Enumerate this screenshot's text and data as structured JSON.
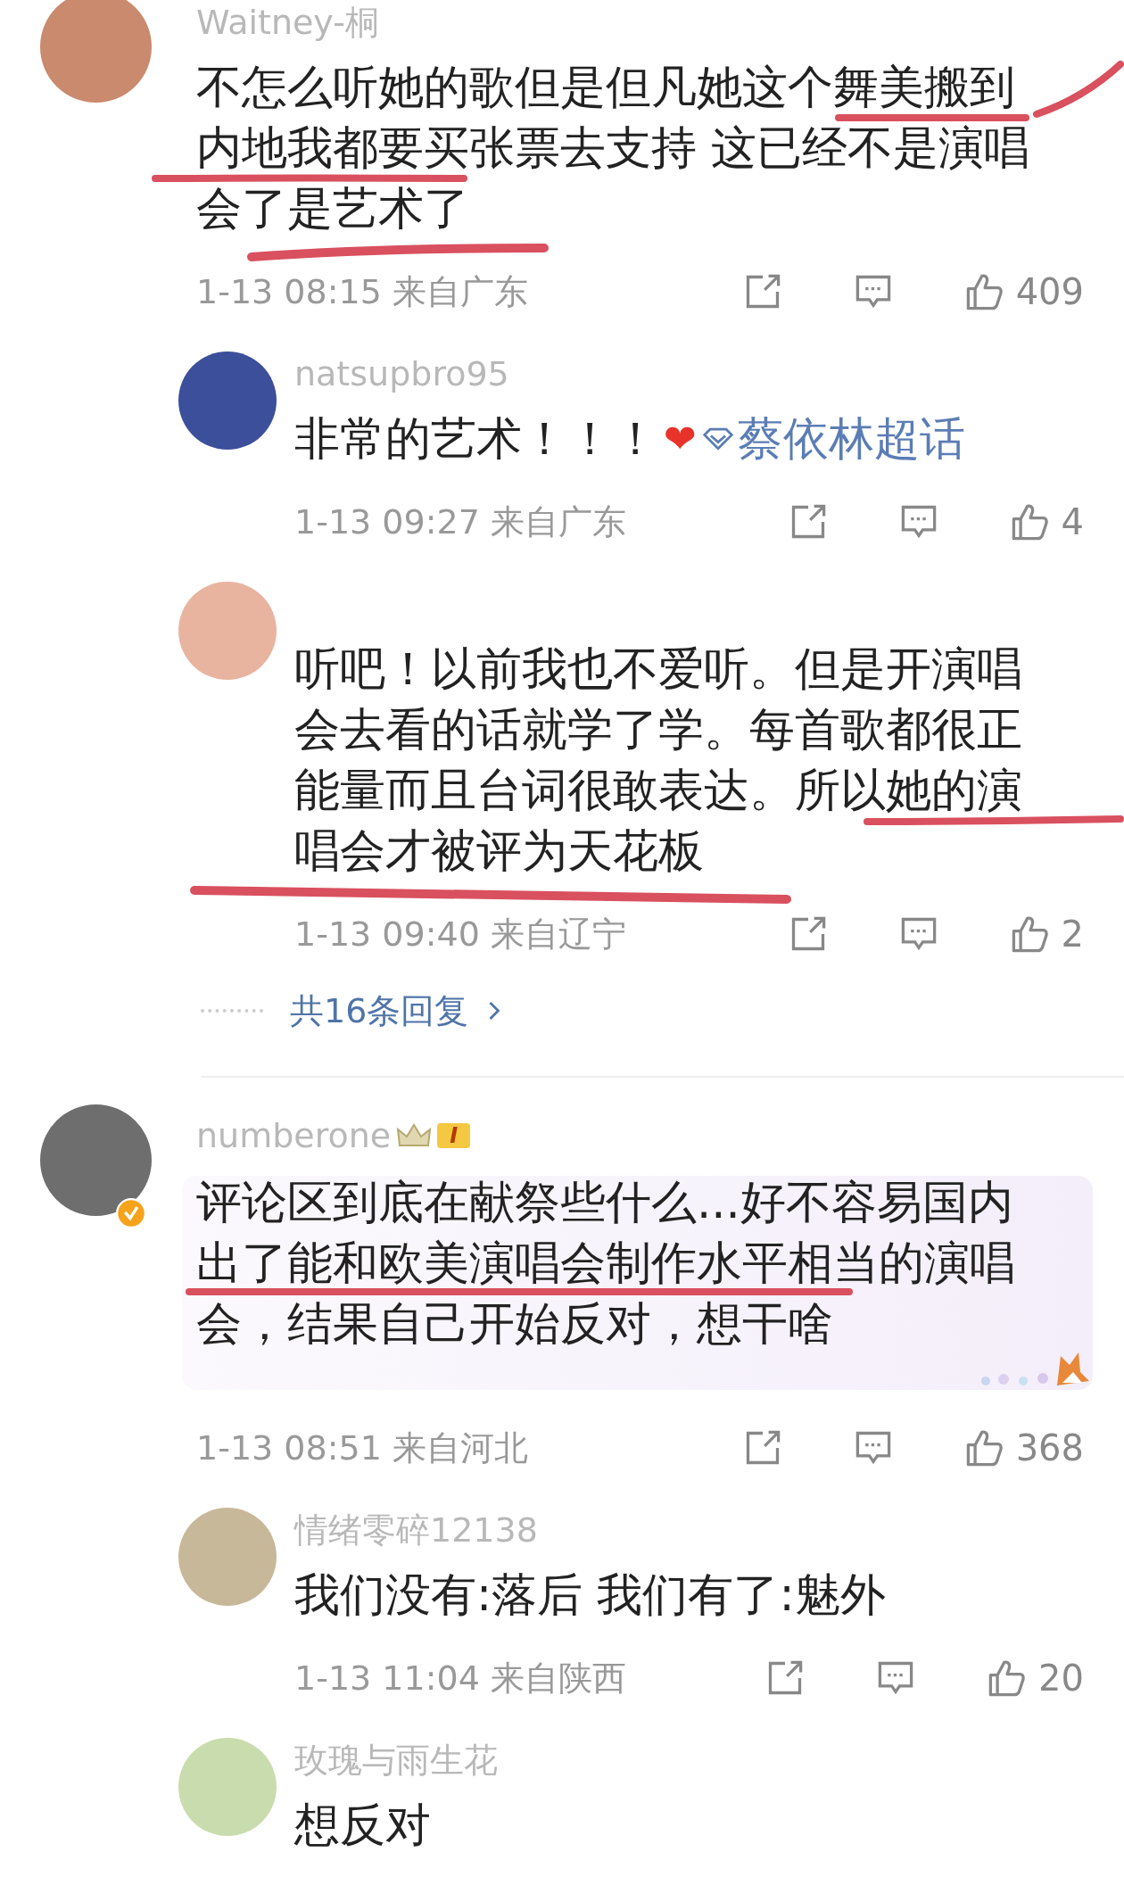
{
  "comments": [
    {
      "name": "Waitney-桐",
      "color": "#c98a6e",
      "verified": false,
      "highlighted": false,
      "text": [
        "不怎么听她的歌但是但凡她这个舞美搬到",
        "内地我都要买张票去支持 这已经不是演唱",
        "会了是艺术了"
      ],
      "time": "1-13 08:15",
      "location": "来自广东",
      "likes": "409",
      "replies": [
        {
          "name": "natsupbro95",
          "color": "#3b4f9a",
          "text": [
            "非常的艺术！！！"
          ],
          "emoji": "❤",
          "topic": "蔡依林超话",
          "time": "1-13 09:27",
          "location": "来自广东",
          "likes": "4"
        },
        {
          "color": "#e8b4a0",
          "text": [
            "听吧！以前我也不爱听。但是开演唱",
            "会去看的话就学了学。每首歌都很正",
            "能量而且台词很敢表达。所以她的演",
            "唱会才被评为天花板"
          ],
          "time": "1-13 09:40",
          "location": "来自辽宁",
          "likes": "2"
        }
      ],
      "more_replies": "共16条回复"
    },
    {
      "name": "numberone",
      "color": "#6e6e6e",
      "verified": true,
      "level_badge": "I",
      "highlighted": true,
      "text": [
        "评论区到底在献祭些什么...好不容易国内",
        "出了能和欧美演唱会制作水平相当的演唱",
        "会，结果自己开始反对，想干啥"
      ],
      "time": "1-13 08:51",
      "location": "来自河北",
      "likes": "368",
      "replies": [
        {
          "name": "情绪零碎12138",
          "color": "#c8b89a",
          "text": [
            "我们没有:落后 我们有了:魅外"
          ],
          "time": "1-13 11:04",
          "location": "来自陕西",
          "likes": "20"
        },
        {
          "name": "玫瑰与雨生花",
          "color": "#c9dcae",
          "text": [
            "想反对"
          ]
        }
      ]
    }
  ]
}
